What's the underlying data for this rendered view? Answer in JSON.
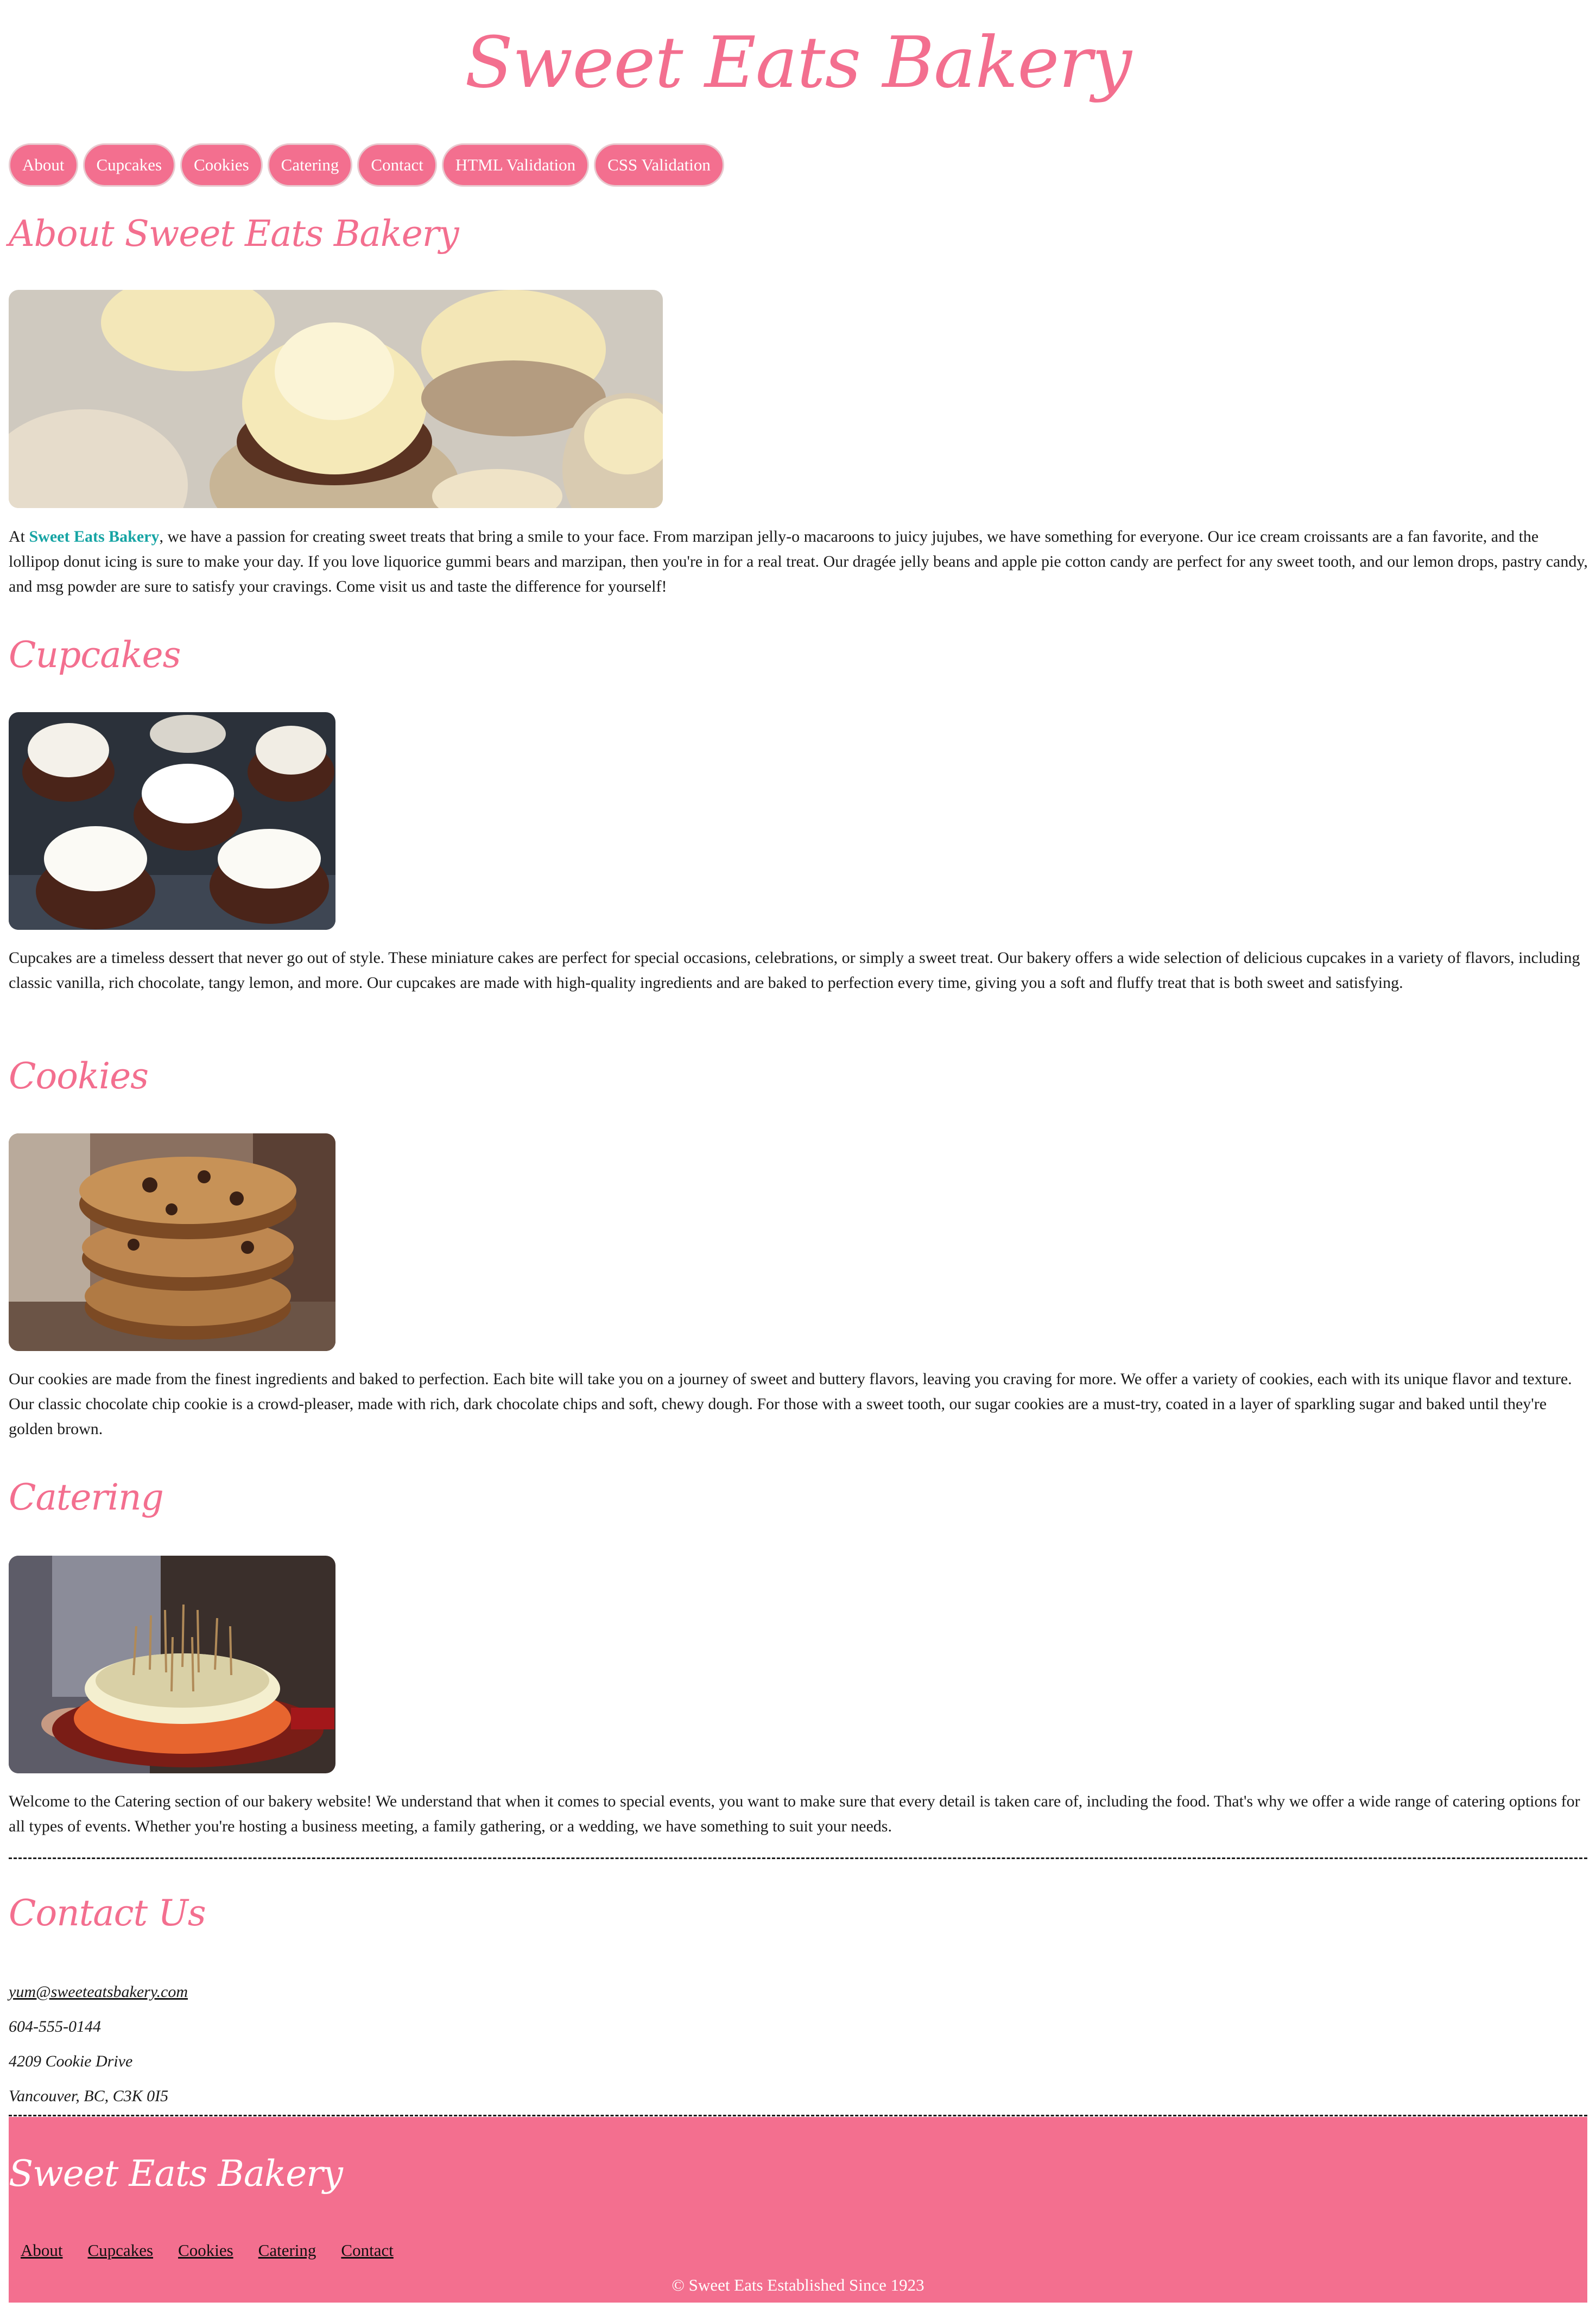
{
  "site": {
    "title": "Sweet Eats Bakery"
  },
  "nav": {
    "items": [
      "About",
      "Cupcakes",
      "Cookies",
      "Catering",
      "Contact",
      "HTML Validation",
      "CSS Validation"
    ]
  },
  "about": {
    "heading": "About Sweet Eats Bakery",
    "lead": "At ",
    "brand": "Sweet Eats Bakery",
    "body": ", we have a passion for creating sweet treats that bring a smile to your face. From marzipan jelly-o macaroons to juicy jujubes, we have something for everyone. Our ice cream croissants are a fan favorite, and the lollipop donut icing is sure to make your day. If you love liquorice gummi bears and marzipan, then you're in for a real treat. Our dragée jelly beans and apple pie cotton candy are perfect for any sweet tooth, and our lemon drops, pastry candy, and msg powder are sure to satisfy your cravings. Come visit us and taste the difference for yourself!",
    "image_icon": "cupcakes-photo"
  },
  "cupcakes": {
    "heading": "Cupcakes",
    "body": "Cupcakes are a timeless dessert that never go out of style. These miniature cakes are perfect for special occasions, celebrations, or simply a sweet treat. Our bakery offers a wide selection of delicious cupcakes in a variety of flavors, including classic vanilla, rich chocolate, tangy lemon, and more. Our cupcakes are made with high-quality ingredients and are baked to perfection every time, giving you a soft and fluffy treat that is both sweet and satisfying.",
    "image_icon": "chocolate-cupcakes-photo"
  },
  "cookies": {
    "heading": "Cookies",
    "body": "Our cookies are made from the finest ingredients and baked to perfection. Each bite will take you on a journey of sweet and buttery flavors, leaving you craving for more. We offer a variety of cookies, each with its unique flavor and texture. Our classic chocolate chip cookie is a crowd-pleaser, made with rich, dark chocolate chips and soft, chewy dough. For those with a sweet tooth, our sugar cookies are a must-try, coated in a layer of sparkling sugar and baked until they're golden brown.",
    "image_icon": "cookie-stack-photo"
  },
  "catering": {
    "heading": "Catering",
    "body": "Welcome to the Catering section of our bakery website! We understand that when it comes to special events, you want to make sure that every detail is taken care of, including the food. That's why we offer a wide range of catering options for all types of events. Whether you're hosting a business meeting, a family gathering, or a wedding, we have something to suit your needs.",
    "image_icon": "cake-with-candles-photo"
  },
  "contact": {
    "heading": "Contact Us",
    "email": "yum@sweeteatsbakery.com",
    "phone": "604-555-0144",
    "street": "4209 Cookie Drive",
    "city": "Vancouver, BC, C3K 0I5"
  },
  "footer": {
    "title": "Sweet Eats Bakery",
    "links": [
      "About",
      "Cupcakes",
      "Cookies",
      "Catering",
      "Contact"
    ],
    "copyright": "© Sweet Eats Established Since 1923"
  },
  "colors": {
    "accent_pink": "#f36f8f",
    "brand_teal": "#16a4a4"
  }
}
